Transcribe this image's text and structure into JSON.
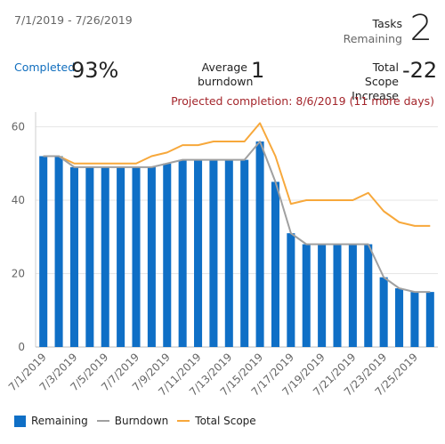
{
  "header": {
    "date_range": "7/1/2019 - 7/26/2019",
    "tasks_label": "Tasks",
    "tasks_sublabel": "Remaining",
    "tasks_value": "2",
    "completed_label": "Completed",
    "completed_value": "93%",
    "avg_label_1": "Average",
    "avg_label_2": "burndown",
    "avg_value": "1",
    "scope_label_1": "Total Scope",
    "scope_label_2": "Increase",
    "scope_value": "-22",
    "projected": "Projected completion: 8/6/2019 (11 more days)"
  },
  "colors": {
    "remaining": "#0f6fc6",
    "burndown": "#a0a0a0",
    "total_scope": "#f7a83b",
    "projected": "#a4262c",
    "completed_label": "#106ebe"
  },
  "chart_data": {
    "type": "bar",
    "categories": [
      "7/1/2019",
      "7/2/2019",
      "7/3/2019",
      "7/4/2019",
      "7/5/2019",
      "7/6/2019",
      "7/7/2019",
      "7/8/2019",
      "7/9/2019",
      "7/10/2019",
      "7/11/2019",
      "7/12/2019",
      "7/13/2019",
      "7/14/2019",
      "7/15/2019",
      "7/16/2019",
      "7/17/2019",
      "7/18/2019",
      "7/19/2019",
      "7/20/2019",
      "7/21/2019",
      "7/22/2019",
      "7/23/2019",
      "7/24/2019",
      "7/25/2019",
      "7/26/2019"
    ],
    "tick_labels": [
      "7/1/2019",
      "7/3/2019",
      "7/5/2019",
      "7/7/2019",
      "7/9/2019",
      "7/11/2019",
      "7/13/2019",
      "7/15/2019",
      "7/17/2019",
      "7/19/2019",
      "7/21/2019",
      "7/23/2019",
      "7/25/2019"
    ],
    "series": [
      {
        "name": "Remaining",
        "kind": "bar",
        "values": [
          52,
          52,
          49,
          49,
          49,
          49,
          49,
          49,
          50,
          51,
          51,
          51,
          51,
          51,
          56,
          45,
          31,
          28,
          28,
          28,
          28,
          28,
          19,
          16,
          15,
          15
        ]
      },
      {
        "name": "Burndown",
        "kind": "line",
        "values": [
          52,
          52,
          49,
          49,
          49,
          49,
          49,
          49,
          50,
          51,
          51,
          51,
          51,
          51,
          56,
          45,
          31,
          28,
          28,
          28,
          28,
          28,
          19,
          16,
          15,
          15
        ]
      },
      {
        "name": "Total Scope",
        "kind": "line",
        "values": [
          52,
          52,
          50,
          50,
          50,
          50,
          50,
          52,
          53,
          55,
          55,
          56,
          56,
          56,
          61,
          52,
          39,
          40,
          40,
          40,
          40,
          42,
          37,
          34,
          33,
          33
        ]
      }
    ],
    "yticks": [
      0,
      20,
      40,
      60
    ],
    "ylim": [
      0,
      64
    ],
    "grid": true,
    "legend": "bottom-left"
  },
  "legend": {
    "remaining": "Remaining",
    "burndown": "Burndown",
    "total_scope": "Total Scope"
  }
}
